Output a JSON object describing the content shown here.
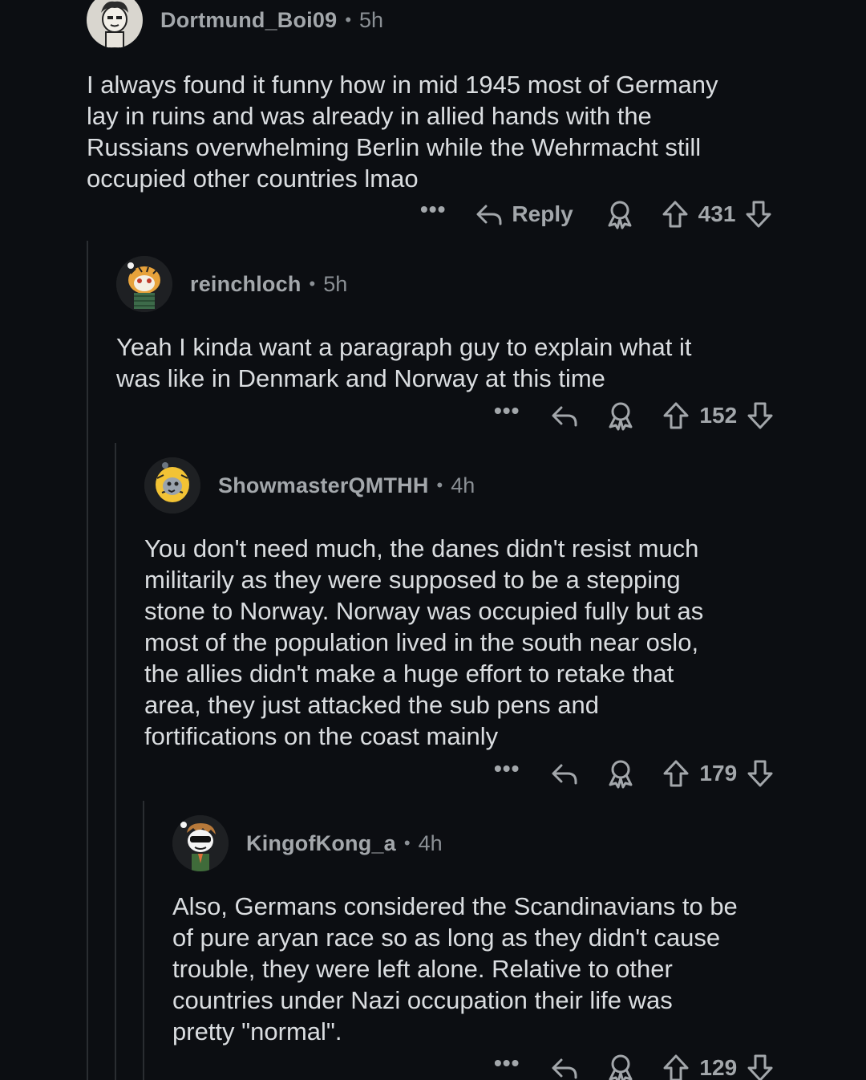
{
  "comments": [
    {
      "username": "Dortmund_Boi09",
      "dot": "•",
      "time": "5h",
      "body": "I always found it funny how in mid 1945 most of Germany\nlay in ruins and was already in allied hands with the\nRussians overwhelming Berlin while the Wehrmacht still\noccupied other countries lmao",
      "reply_label": "Reply",
      "more_label": "•••",
      "score": "431"
    },
    {
      "username": "reinchloch",
      "dot": "•",
      "time": "5h",
      "body": "Yeah I kinda want a paragraph guy to explain what it\nwas like in Denmark and Norway at this time",
      "more_label": "•••",
      "score": "152"
    },
    {
      "username": "ShowmasterQMTHH",
      "dot": "•",
      "time": "4h",
      "body": "You don't need much, the danes didn't resist much\nmilitarily as they were supposed to be a stepping\nstone to Norway. Norway was occupied fully but as\nmost of the population lived in the south near oslo,\nthe allies didn't make a huge effort to retake that\narea, they just attacked the sub pens and\nfortifications on the coast mainly",
      "more_label": "•••",
      "score": "179"
    },
    {
      "username": "KingofKong_a",
      "dot": "•",
      "time": "4h",
      "body": "Also, Germans considered the Scandinavians to be\nof pure aryan race so as long as they didn't cause\ntrouble, they were left alone. Relative to other\ncountries under Nazi occupation their life was\npretty \"normal\".",
      "more_label": "•••",
      "score": "129"
    }
  ],
  "icons": {
    "reply": "reply-arrow-icon",
    "award": "award-icon",
    "upvote": "upvote-arrow-icon",
    "downvote": "downvote-arrow-icon",
    "more": "more-options-icon"
  },
  "colors": {
    "background": "#0c0e12",
    "text": "#dadde0",
    "meta": "#a3a7ab",
    "thread_line": "#2a2d31"
  }
}
